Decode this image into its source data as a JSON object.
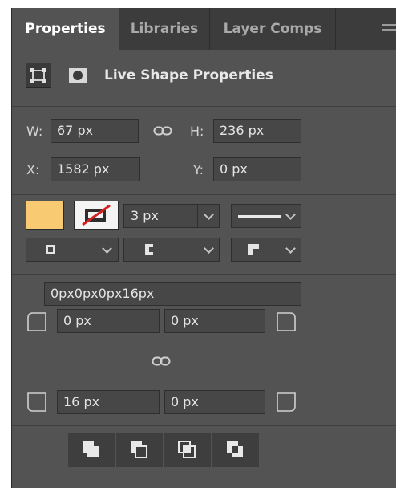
{
  "tabs": [
    {
      "label": "Properties",
      "active": true
    },
    {
      "label": "Libraries",
      "active": false
    },
    {
      "label": "Layer Comps",
      "active": false
    }
  ],
  "section_title": "Live Shape Properties",
  "transform": {
    "w_label": "W:",
    "w_value": "67 px",
    "h_label": "H:",
    "h_value": "236 px",
    "x_label": "X:",
    "x_value": "1582 px",
    "y_label": "Y:",
    "y_value": "0 px"
  },
  "appearance": {
    "fill_color": "#f8ca72",
    "stroke": "none",
    "stroke_width": "3 px",
    "stroke_type": "solid"
  },
  "corners": {
    "combined": "0px0px0px16px",
    "top_left": "0 px",
    "top_right": "0 px",
    "bottom_left": "16 px",
    "bottom_right": "0 px"
  },
  "colors": {
    "panel_bg": "#535353",
    "tabbar_bg": "#3c3c3c",
    "field_bg": "#474747"
  }
}
